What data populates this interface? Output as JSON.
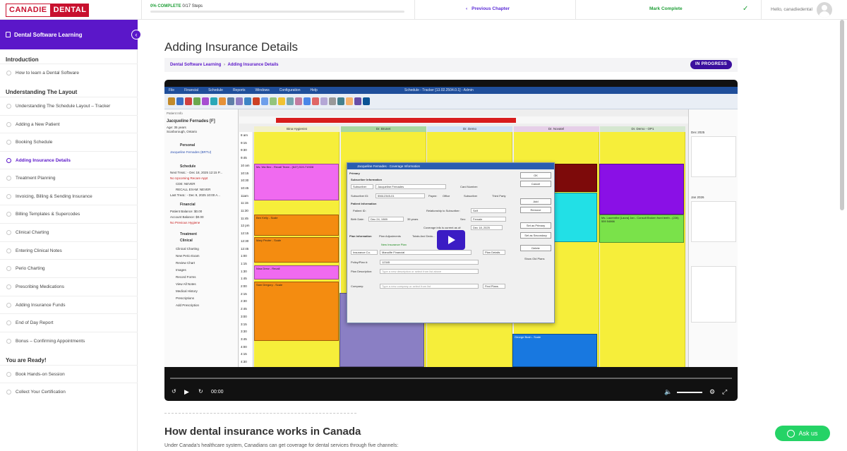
{
  "brand": {
    "logo_left": "CANADIE",
    "logo_right": "DENTAL"
  },
  "topbar": {
    "progress_pct": "0% COMPLETE",
    "progress_steps": "0/17 Steps",
    "progress_value": 0,
    "previous_chapter": "Previous Chapter",
    "mark_complete": "Mark Complete",
    "hello": "Hello, canadiedental"
  },
  "sidebar": {
    "course_title": "Dental Software Learning",
    "sections": [
      {
        "heading": "Introduction",
        "lessons": [
          "How to learn a Dental Software"
        ]
      },
      {
        "heading": "Understanding The Layout",
        "lessons": [
          "Understanding The Schedule Layout – Tracker",
          "Adding a New Patient",
          "Booking Schedule",
          "Adding Insurance Details",
          "Treatment Planning",
          "Invoicing, Billing & Sending Insurance",
          "Billing Templates & Supercodes",
          "Clinical Charting",
          "Entering Clinical Notes",
          "Perio Charting",
          "Prescribing Medications",
          "Adding Insurance Funds",
          "End of Day Report",
          "Bonus – Confirming Appointments"
        ]
      },
      {
        "heading": "You are Ready!",
        "lessons": [
          "Book Hands-on Session",
          "Collect Your Certification"
        ]
      }
    ],
    "active_lesson": "Adding Insurance Details"
  },
  "main": {
    "title": "Adding Insurance Details",
    "breadcrumb_course": "Dental Software Learning",
    "breadcrumb_sep": "›",
    "breadcrumb_lesson": "Adding Insurance Details",
    "status": "IN PROGRESS",
    "section_heading": "How dental insurance works in Canada",
    "paragraph": "Under Canada's healthcare system, Canadians can get coverage for dental services through five channels:"
  },
  "video": {
    "app_title": "Schedule - Tracker [13.02.2504.0.1] - Admin",
    "menu": [
      "File",
      "Financial",
      "Schedule",
      "Reports",
      "Windows",
      "Configuration",
      "Help"
    ],
    "patient": {
      "name": "Jacqueline Fernades  [F]",
      "age": "Age: 35 years",
      "city": "Scarborough, Ontario",
      "personal": "Personal",
      "personal_row": "Jacqueline Fernades (BRTU)",
      "schedule": "Schedule",
      "next_treat": "Next Treat.: - Dec 18, 2025 12:15 P...",
      "no_recare": "No Upcoming Recare Appt",
      "cde": "CDE: NEVER",
      "recall": "RECALL EXAM: NEVER",
      "last_treat": "Last Treat.: - Dec 9, 2025 10:00 A...",
      "financial": "Financial",
      "patient_balance": "Patient Balance: $0.00",
      "account_balance": "Account Balance: $0.00",
      "no_hygiene": "No Previous Hygiene",
      "treatment": "Treatment",
      "clinical": "Clinical",
      "clinical_items": [
        "Clinical Charting",
        "New Perio Exam",
        "Review Chart",
        "Images",
        "Record Forms",
        "View All Notes",
        "Medical History",
        "Prescriptions",
        "Add Prescription"
      ]
    },
    "columns": [
      "Bina Hygienist",
      "Dr. Brunet",
      "Dr. Demo",
      "Dr. Novatel",
      "Dr. Demo - OP1"
    ],
    "times": [
      "8 am",
      "9:15",
      "9:30",
      "9:45",
      "10 am",
      "10:15",
      "10:30",
      "10:45",
      "11am",
      "11:15",
      "11:30",
      "11:45",
      "12 pm",
      "12:15",
      "12:30",
      "12:45",
      "1:00",
      "1:15",
      "1:30",
      "1:45",
      "2:00",
      "2:15",
      "2:30",
      "2:45",
      "3:00",
      "3:15",
      "3:30",
      "3:45",
      "4:00",
      "4:15",
      "4:30"
    ],
    "appointments": {
      "a1": "Ms. Wa Bez - Recall Team - (647) 519-7193/8",
      "a2": "Ben Kelly - Scale",
      "a3": "Mary Pecter - Scale",
      "a4": "Nina Drew - Recall",
      "a5": "Sam Dregory - Scale",
      "a6": "Ms. Laurenthe [Laura] Jan - Consult Broken front teeth - (226) 559 54866",
      "a7": "George Bush - Scale"
    },
    "dialog": {
      "title": "Jacqueline Fernades - Coverage Information",
      "primary": "Primary",
      "subscriber_info": "Subscriber Information",
      "subscriber_label": "Subscriber",
      "subscriber_value": "Jacqueline Fernades",
      "card_number": "Card Number:",
      "subscriber_id_label": "Subscriber ID:",
      "subscriber_id": "55612345-01",
      "payee": "Payee:",
      "office": "Office",
      "subscriber_opt": "Subscriber",
      "third_party": "Third Party",
      "patient_info": "Patient Information",
      "patient_id": "Patient ID:",
      "relationship": "Relationship to Subscriber:",
      "relationship_value": "Self",
      "birth_date_label": "Birth Date:",
      "birth_date": "Dec 24, 1989",
      "age": "35 years",
      "sex_label": "Sex:",
      "sex": "Female",
      "coverage_label": "Coverage info is current as of:",
      "coverage_date": "Dec 18, 2025",
      "tabs": [
        "Plan Information",
        "Plan Adjustments",
        "Totals And Dedu..."
      ],
      "new_plan": "New Insurance Plan",
      "insurance_co": "Insurance Co.",
      "insurance_value": "Manulife Financial",
      "policy_label": "Policy/Plan #:",
      "policy_value": "12345",
      "plan_desc": "Plan Description:",
      "plan_desc_ph": "Type a new description or select from list above",
      "company_label": "Company:",
      "company_ph": "Type a new company or select from list",
      "buttons": [
        "OK",
        "Cancel",
        "Add",
        "Remove",
        "Set as Primary",
        "Set as Secondary",
        "Delete"
      ],
      "plan_details": "Plan Details",
      "find_plans": "Find Plans",
      "show_old": "Show Old Plans"
    },
    "calendar": {
      "month1": "Dec 2025",
      "month2": "Jan 2026"
    },
    "time_display": "00:00"
  },
  "whatsapp": {
    "label": "Ask us"
  }
}
